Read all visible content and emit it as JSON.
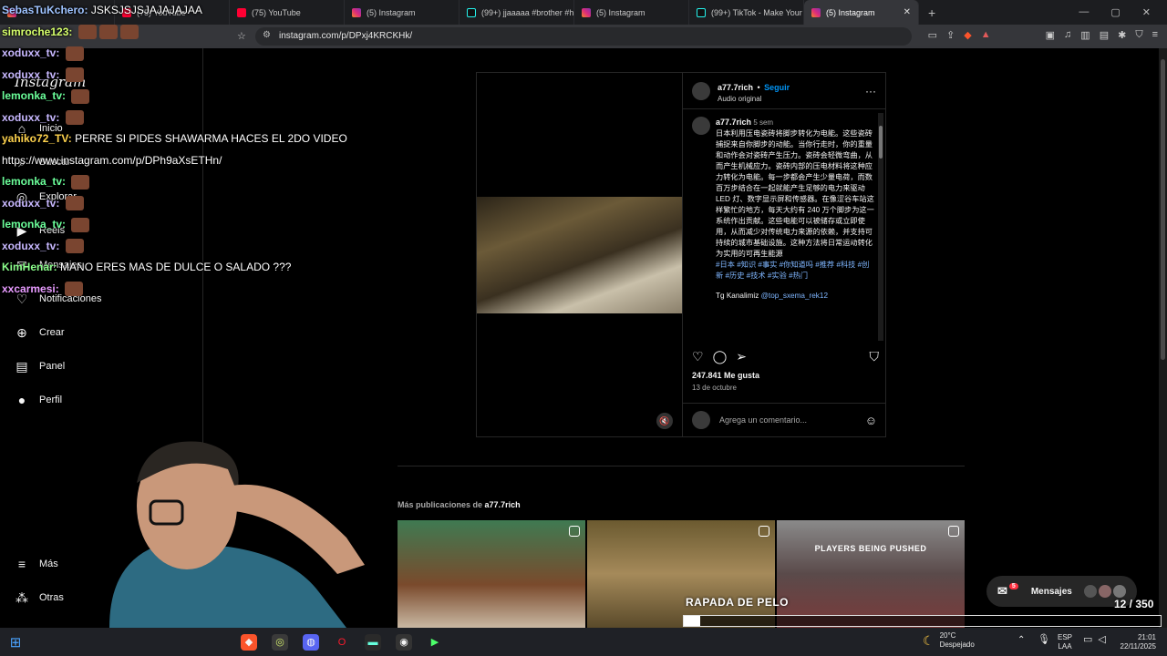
{
  "browser": {
    "tabs": [
      {
        "title": "",
        "icon": "twitch-icon",
        "active": false
      },
      {
        "title": "(75) YouTube",
        "icon": "youtube-icon",
        "active": false
      },
      {
        "title": "(75) YouTube",
        "icon": "youtube-icon",
        "active": false
      },
      {
        "title": "(5) Instagram",
        "icon": "instagram-icon",
        "active": false
      },
      {
        "title": "(99+) jjaaaaa #brother #he",
        "icon": "tiktok-icon",
        "active": false
      },
      {
        "title": "(5) Instagram",
        "icon": "instagram-icon",
        "active": false
      },
      {
        "title": "(99+) TikTok - Make Your D",
        "icon": "tiktok-icon",
        "active": false
      },
      {
        "title": "(5) Instagram",
        "icon": "instagram-icon",
        "active": true
      }
    ],
    "url": "instagram.com/p/DPxj4KRCKHk/"
  },
  "sidebar": {
    "logo": "Instagram",
    "items": [
      {
        "label": "Inicio",
        "icon": "home-icon"
      },
      {
        "label": "Buscar",
        "icon": "search-icon"
      },
      {
        "label": "Explorar",
        "icon": "compass-icon"
      },
      {
        "label": "Reels",
        "icon": "reels-icon"
      },
      {
        "label": "Mensajes",
        "icon": "messenger-icon"
      },
      {
        "label": "Notificaciones",
        "icon": "heart-icon"
      },
      {
        "label": "Crear",
        "icon": "plus-square-icon"
      },
      {
        "label": "Panel",
        "icon": "chart-icon"
      },
      {
        "label": "Perfil",
        "icon": "profile-avatar"
      }
    ],
    "bottom": [
      {
        "label": "Más",
        "icon": "menu-icon"
      },
      {
        "label": "Otras",
        "icon": "grid-icon"
      }
    ]
  },
  "post": {
    "username": "a77.7rich",
    "follow": "Seguir",
    "audio": "Audio original",
    "caption_user": "a77.7rich",
    "caption_age": "5 sem",
    "caption_text": "日本利用压电瓷砖将脚步转化为电能。这些瓷砖捕捉来自你脚步的动能。当你行走时，你的重量和动作会对瓷砖产生压力。瓷砖会轻微弯曲，从而产生机械应力。瓷砖内部的压电材料将这种应力转化为电能。每一步都会产生少量电荷，而数百万步结合在一起就能产生足够的电力来驱动 LED 灯、数字显示屏和传感器。在像涩谷车站这样繁忙的地方，每天大约有 240 万个脚步为这一系统作出贡献。这些电能可以被储存或立即使用，从而减少对传统电力来源的依赖，并支持可持续的城市基础设施。这种方法将日常运动转化为实用的可再生能源",
    "hashtags": "#日本 #知识 #事实 #你知道吗 #推荐 #科技 #创新 #历史 #技术 #实验 #热门",
    "comment_user": "Tg Kanalimiz",
    "comment_mention": "@top_sxema_rek12",
    "likes": "247.841 Me gusta",
    "date": "13 de octubre",
    "comment_placeholder": "Agrega un comentario..."
  },
  "more_posts": {
    "label_prefix": "Más publicaciones de",
    "label_user": "a77.7rich",
    "thumb_texts": [
      "",
      "",
      "PLAYERS BEING PUSHED"
    ]
  },
  "messages": {
    "label": "Mensajes",
    "badge": "5"
  },
  "chat": [
    {
      "user": "SebasTuKchero:",
      "msg": "JSKSJSJSJAJAJAJAA",
      "color": "#9ec3ff"
    },
    {
      "user": "simroche123:",
      "msg": "",
      "color": "#d6ff6b",
      "emotes": 3
    },
    {
      "user": "xoduxx_tv:",
      "msg": "",
      "color": "#c8b8ff",
      "emotes": 1
    },
    {
      "user": "xoduxx_tv:",
      "msg": "",
      "color": "#c8b8ff",
      "emotes": 1
    },
    {
      "user": "lemonka_tv:",
      "msg": "",
      "color": "#6bff9a",
      "emotes": 1
    },
    {
      "user": "xoduxx_tv:",
      "msg": "",
      "color": "#c8b8ff",
      "emotes": 1
    },
    {
      "user": "yahiko72_TV:",
      "msg": "PERRE SI PIDES SHAWARMA HACES EL 2DO VIDEO",
      "color": "#ffd34d"
    },
    {
      "user": "",
      "msg": "https://www.instagram.com/p/DPh9aXsETHn/",
      "color": "#ffffff"
    },
    {
      "user": "lemonka_tv:",
      "msg": "",
      "color": "#6bff9a",
      "emotes": 1
    },
    {
      "user": "xoduxx_tv:",
      "msg": "",
      "color": "#c8b8ff",
      "emotes": 1
    },
    {
      "user": "lemonka_tv:",
      "msg": "",
      "color": "#6bff9a",
      "emotes": 1
    },
    {
      "user": "xoduxx_tv:",
      "msg": "",
      "color": "#c8b8ff",
      "emotes": 1
    },
    {
      "user": "KimHenar:",
      "msg": "MANO ERES MAS DE DULCE O SALADO ???",
      "color": "#8cff8c"
    },
    {
      "user": "xxcarmesi:",
      "msg": "",
      "color": "#e89bff",
      "emotes": 1
    }
  ],
  "stream_overlay": {
    "title": "RAPADA DE PELO",
    "counter": "12  / 350",
    "progress": 0.034
  },
  "taskbar": {
    "weather_temp": "20°C",
    "weather_desc": "Despejado",
    "lang1": "ESP",
    "lang2": "LAA",
    "time": "21:01",
    "date": "22/11/2025"
  }
}
